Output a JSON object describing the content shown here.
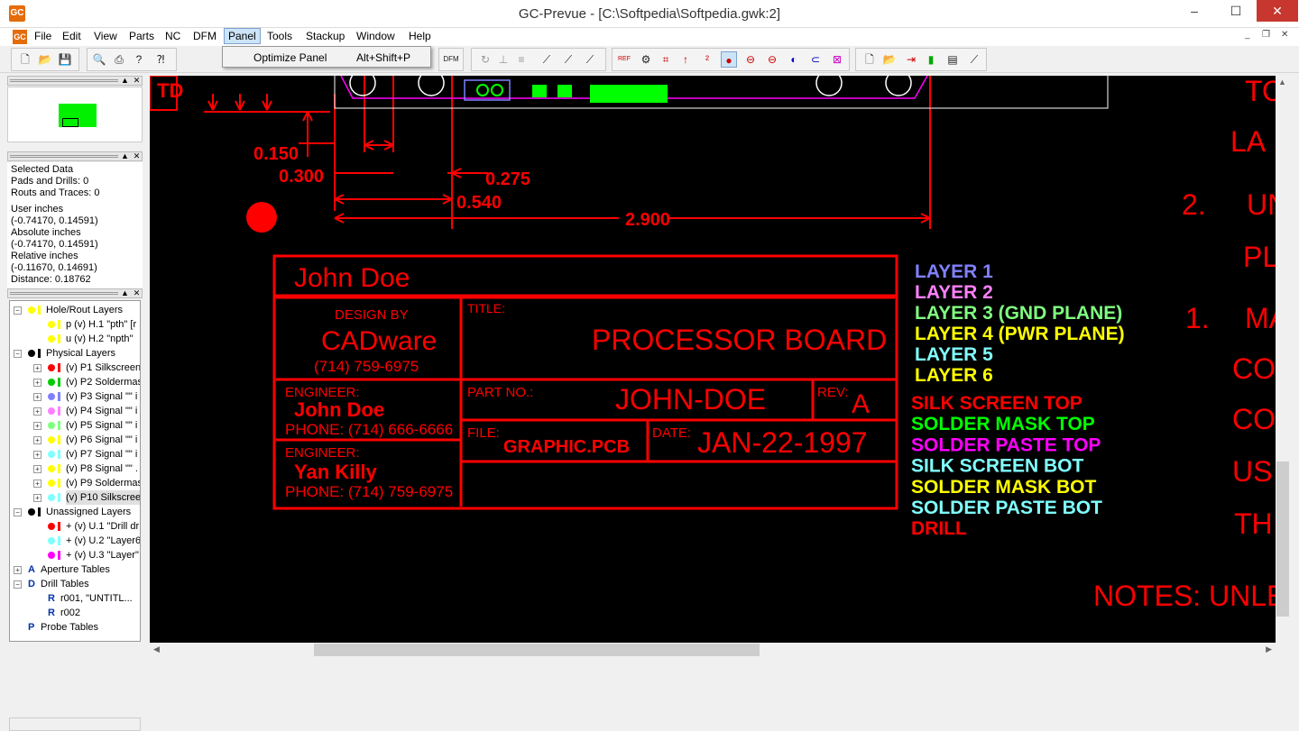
{
  "window": {
    "title": "GC-Prevue - [C:\\Softpedia\\Softpedia.gwk:2]",
    "icon": "GC",
    "min": "–",
    "max": "☐",
    "close": "✕"
  },
  "menu": {
    "items": [
      "File",
      "Edit",
      "View",
      "Parts",
      "NC",
      "DFM",
      "Panel",
      "Tools",
      "Stackup",
      "Window",
      "Help"
    ],
    "active": "Panel",
    "mdi": [
      "_",
      "❐",
      "✕"
    ]
  },
  "dropdown": {
    "label": "Optimize Panel",
    "shortcut": "Alt+Shift+P"
  },
  "left_panel": {
    "info_lines": [
      "Selected Data",
      "Pads and Drills: 0",
      "Routs and Traces: 0",
      "User inches",
      "(-0.74170,  0.14591)",
      "Absolute inches",
      "(-0.74170,  0.14591)",
      "Relative inches",
      "(-0.11670,  0.14691)",
      "Distance:  0.18762"
    ],
    "tree": [
      {
        "label": "Hole/Rout Layers",
        "level": 0,
        "exp": "−",
        "color": "#ffff00"
      },
      {
        "label": "p (v) H.1 \"pth\" [r",
        "level": 1,
        "color": "#ffff00"
      },
      {
        "label": "u (v) H.2 \"npth\"",
        "level": 1,
        "color": "#ffff00"
      },
      {
        "label": "Physical Layers",
        "level": 0,
        "exp": "−",
        "color": "#000000"
      },
      {
        "label": "(v) P1 Silkscreen",
        "level": 1,
        "exp": "+",
        "color": "#ff0000"
      },
      {
        "label": "(v) P2 Soldermas",
        "level": 1,
        "exp": "+",
        "color": "#00cc00"
      },
      {
        "label": "(v) P3 Signal \"\" i",
        "level": 1,
        "exp": "+",
        "color": "#8080ff"
      },
      {
        "label": "(v) P4 Signal \"\" i",
        "level": 1,
        "exp": "+",
        "color": "#ff80ff"
      },
      {
        "label": "(v) P5 Signal \"\" i",
        "level": 1,
        "exp": "+",
        "color": "#80ff80"
      },
      {
        "label": "(v) P6 Signal \"\" i",
        "level": 1,
        "exp": "+",
        "color": "#ffff00"
      },
      {
        "label": "(v) P7 Signal \"\" i",
        "level": 1,
        "exp": "+",
        "color": "#80ffff"
      },
      {
        "label": "(v) P8 Signal \"\" .",
        "level": 1,
        "exp": "+",
        "color": "#ffff00"
      },
      {
        "label": "(v) P9 Soldermas",
        "level": 1,
        "exp": "+",
        "color": "#ffff00"
      },
      {
        "label": "(v) P10 Silkscree",
        "level": 1,
        "exp": "+",
        "color": "#80ffff"
      },
      {
        "label": "Unassigned Layers",
        "level": 0,
        "exp": "−",
        "color": "#000000"
      },
      {
        "label": "+ (v) U.1 \"Drill dr",
        "level": 1,
        "color": "#ff0000"
      },
      {
        "label": "+ (v) U.2 \"Layer6",
        "level": 1,
        "color": "#80ffff"
      },
      {
        "label": "+ (v) U.3 \"Layer\"",
        "level": 1,
        "color": "#ff00ff"
      },
      {
        "label": "Aperture Tables",
        "level": 0,
        "exp": "+",
        "icon": "A"
      },
      {
        "label": "Drill Tables",
        "level": 0,
        "exp": "−",
        "icon": "D"
      },
      {
        "label": "r001, \"UNTITL...",
        "level": 1,
        "icon": "R"
      },
      {
        "label": "r002",
        "level": 1,
        "icon": "R"
      },
      {
        "label": "Probe Tables",
        "level": 0,
        "icon": "P"
      }
    ]
  },
  "drawing": {
    "dims": [
      "0.150",
      "0.300",
      "0.275",
      "0.540",
      "2.900"
    ],
    "td": "TD",
    "name": "John Doe",
    "design_by": "DESIGN BY",
    "company": "CADware",
    "company_phone": "(714) 759-6975",
    "title_label": "TITLE:",
    "title": "PROCESSOR BOARD",
    "engineer_label": "ENGINEER:",
    "engineer1": "John Doe",
    "phone1": "PHONE: (714) 666-6666",
    "engineer2": "Yan Killy",
    "phone2": "PHONE: (714) 759-6975",
    "part_label": "PART NO.:",
    "part": "JOHN-DOE",
    "rev_label": "REV:",
    "rev": "A",
    "file_label": "FILE:",
    "file": "GRAPHIC.PCB",
    "date_label": "DATE:",
    "date": "JAN-22-1997",
    "legend": [
      {
        "t": "LAYER 1",
        "c": "#8080ff"
      },
      {
        "t": "LAYER 2",
        "c": "#ff80ff"
      },
      {
        "t": "LAYER 3 (GND PLANE)",
        "c": "#80ff80"
      },
      {
        "t": "LAYER 4 (PWR PLANE)",
        "c": "#ffff00"
      },
      {
        "t": "LAYER 5",
        "c": "#80ffff"
      },
      {
        "t": "LAYER 6",
        "c": "#ffff00"
      },
      {
        "t": "SILK SCREEN TOP",
        "c": "#ff0000"
      },
      {
        "t": "SOLDER MASK TOP",
        "c": "#00ff00"
      },
      {
        "t": "SOLDER PASTE TOP",
        "c": "#ff00ff"
      },
      {
        "t": "SILK SCREEN BOT",
        "c": "#80ffff"
      },
      {
        "t": "SOLDER MASK BOT",
        "c": "#ffff00"
      },
      {
        "t": "SOLDER PASTE BOT",
        "c": "#80ffff"
      },
      {
        "t": "DRILL",
        "c": "#ff0000"
      }
    ],
    "notes": [
      "TO",
      "LA",
      "2.",
      "UN",
      "PL",
      "1.",
      "MA",
      "CO",
      "CO",
      "US",
      "TH"
    ],
    "notes_footer": "NOTES:  UNLE"
  }
}
